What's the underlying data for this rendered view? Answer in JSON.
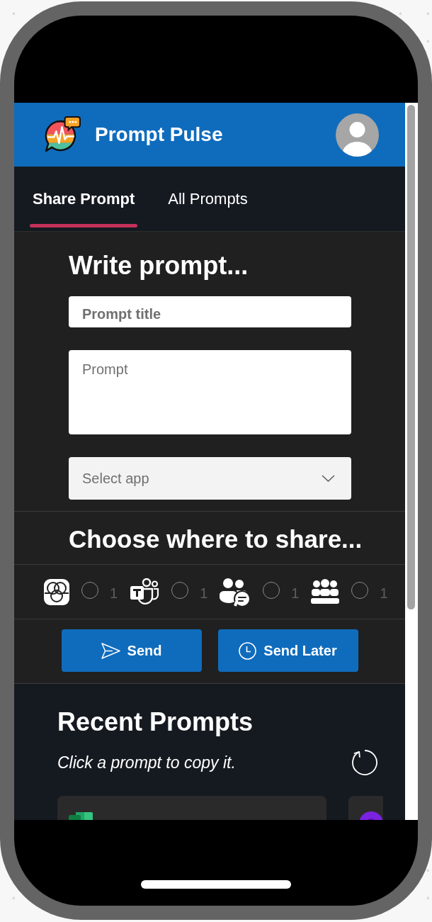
{
  "app": {
    "title": "Prompt Pulse"
  },
  "tabs": [
    {
      "label": "Share Prompt",
      "selected": true
    },
    {
      "label": "All Prompts",
      "selected": false
    }
  ],
  "compose": {
    "heading": "Write prompt...",
    "title_field": {
      "placeholder": "Prompt title"
    },
    "prompt_field": {
      "placeholder": "Prompt"
    },
    "app_select": {
      "placeholder": "Select app"
    }
  },
  "share": {
    "heading": "Choose where to share...",
    "targets": [
      {
        "kind": "loop",
        "selected": false,
        "count": "1"
      },
      {
        "kind": "teams",
        "selected": false,
        "count": "1"
      },
      {
        "kind": "chat",
        "selected": false,
        "count": "1"
      },
      {
        "kind": "group",
        "selected": false,
        "count": "1"
      }
    ]
  },
  "actions": [
    {
      "kind": "send",
      "label": "Send"
    },
    {
      "kind": "schedule",
      "label": "Send Later"
    }
  ],
  "recent": {
    "heading": "Recent Prompts",
    "hint": "Click a prompt to copy it.",
    "cards": [
      {
        "kind": "sheet"
      },
      {
        "kind": "ring"
      }
    ]
  }
}
